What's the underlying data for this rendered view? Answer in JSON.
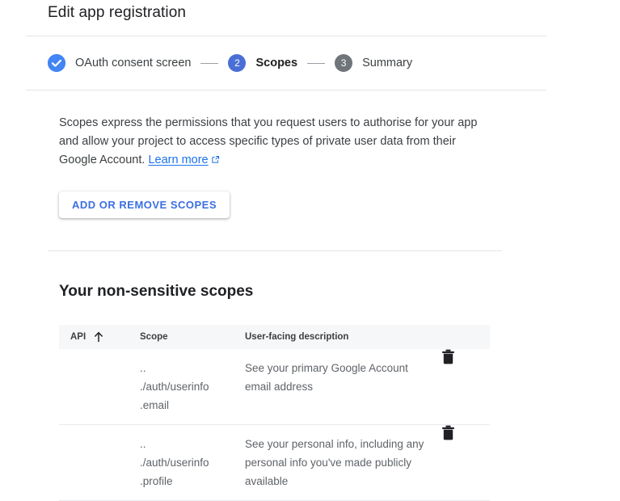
{
  "page_title": "Edit app registration",
  "stepper": {
    "steps": [
      {
        "marker": "check-circle-icon",
        "state": "done",
        "label": "OAuth consent screen"
      },
      {
        "marker": "2",
        "state": "active",
        "label": "Scopes"
      },
      {
        "marker": "3",
        "state": "todo",
        "label": "Summary"
      }
    ]
  },
  "description": {
    "text": "Scopes express the permissions that you request users to authorise for your app and allow your project to access specific types of private user data from their Google Account.",
    "link_label": "Learn more",
    "link_icon": "external-link-icon"
  },
  "actions": {
    "add_remove_scopes_label": "ADD OR REMOVE SCOPES"
  },
  "section": {
    "heading": "Your non-sensitive scopes"
  },
  "table": {
    "columns": {
      "api": "API",
      "scope": "Scope",
      "description": "User-facing description",
      "sort_icon": "sort-ascending-arrow-icon"
    },
    "rows": [
      {
        "api": "",
        "scope_lines": [
          "..",
          "./auth/userinfo",
          ".email"
        ],
        "description": "See your primary Google Account email address",
        "delete_icon": "trash-icon"
      },
      {
        "api": "",
        "scope_lines": [
          "..",
          "./auth/userinfo",
          ".profile"
        ],
        "description": "See your personal info, including any personal info you've made publicly available",
        "delete_icon": "trash-icon"
      }
    ]
  },
  "colors": {
    "accent_blue": "#1a73e8",
    "step_done": "#4285f4",
    "step_active": "#4a6fd4",
    "step_todo": "#70757a",
    "divider": "#e3e4e6",
    "table_header_bg": "#f6f7f8"
  }
}
